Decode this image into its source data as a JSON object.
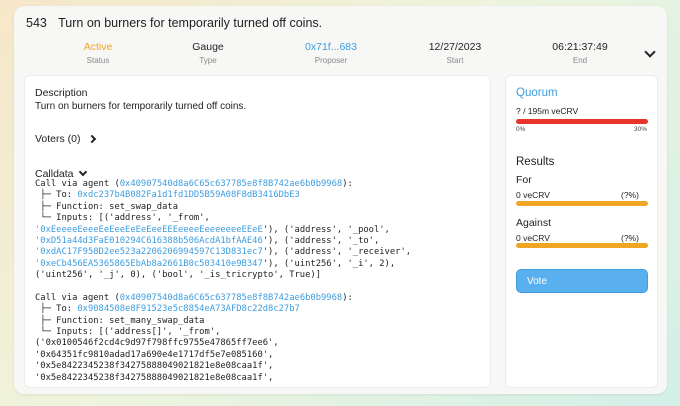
{
  "proposal": {
    "number": "543",
    "title": "Turn on burners for temporarily turned off coins."
  },
  "meta": [
    {
      "value": "Active",
      "label": "Status",
      "color": "#f1a623"
    },
    {
      "value": "Gauge",
      "label": "Type",
      "color": "#222222"
    },
    {
      "value": "0x71f...683",
      "label": "Proposer",
      "color": "#3d9de0"
    },
    {
      "value": "12/27/2023",
      "label": "Start",
      "color": "#222222"
    },
    {
      "value": "06:21:37:49",
      "label": "End",
      "color": "#222222"
    }
  ],
  "description": {
    "heading": "Description",
    "text": "Turn on burners for temporarily turned off coins."
  },
  "voters_label": "Voters (0)",
  "calldata_label": "Calldata",
  "calldata_lines": [
    [
      {
        "t": "Call via agent ("
      },
      {
        "t": "0x40907540d8a6C65c637785e8f8B742ae6b0b9968",
        "a": true
      },
      {
        "t": "):"
      }
    ],
    [
      {
        "t": " ├─ To: "
      },
      {
        "t": "0xdc237b4B082Fa1d1fd1DD5B59A08F8dB3416DbE3",
        "a": true
      }
    ],
    [
      {
        "t": " ├─ Function: set_swap_data"
      }
    ],
    [
      {
        "t": " └─ Inputs: [('address', '_from',"
      }
    ],
    [
      {
        "t": "'0xEeeeeEeeeEeEeeEeEeEeeEEEeeeeEeeeeeeeEEeE",
        "a": true
      },
      {
        "t": "'), ('address', '_pool',"
      }
    ],
    [
      {
        "t": "'0xD51a44d3FaE010294C616388b506AcdA1bfAAE46",
        "a": true
      },
      {
        "t": "'), ('address', '_to',"
      }
    ],
    [
      {
        "t": "'0xdAC17F958D2ee523a2206206994597C13D831ec7",
        "a": true
      },
      {
        "t": "'), ('address', '_receiver',"
      }
    ],
    [
      {
        "t": "'0xeCb456EA5365865EbAb8a2661B0c503410e9B347",
        "a": true
      },
      {
        "t": "'), ('uint256', '_i', 2),"
      }
    ],
    [
      {
        "t": "('uint256', '_j', 0), ('bool', '_is_tricrypto', True)]"
      }
    ],
    [],
    [
      {
        "t": "Call via agent ("
      },
      {
        "t": "0x40907540d8a6C65c637785e8f8B742ae6b0b9968",
        "a": true
      },
      {
        "t": "):"
      }
    ],
    [
      {
        "t": " ├─ To: "
      },
      {
        "t": "0x9084508e8F91523e5c8854eA73AFD8c22d8c27b7",
        "a": true
      }
    ],
    [
      {
        "t": " ├─ Function: set_many_swap_data"
      }
    ],
    [
      {
        "t": " └─ Inputs: [('address[]', '_from',"
      }
    ],
    [
      {
        "t": "('0x0100546f2cd4c9d97f798ffc9755e47865ff7ee6',"
      }
    ],
    [
      {
        "t": "'0x64351fc9810adad17a690e4e1717df5e7e085160',"
      }
    ],
    [
      {
        "t": "'0x5e8422345238f34275888049021821e8e08caa1f',"
      }
    ],
    [
      {
        "t": "'0x5e8422345238f34275888049021821e8e08caa1f',"
      }
    ]
  ],
  "quorum": {
    "title": "Quorum",
    "value": "? / 195m veCRV",
    "min_label": "0%",
    "max_label": "30%",
    "bar_color": "#e8352a"
  },
  "results": {
    "heading": "Results",
    "for": {
      "label": "For",
      "amount": "0 veCRV",
      "pct": "(?%)"
    },
    "against": {
      "label": "Against",
      "amount": "0 veCRV",
      "pct": "(?%)"
    },
    "bar_color": "#f1a623"
  },
  "vote_label": "Vote"
}
